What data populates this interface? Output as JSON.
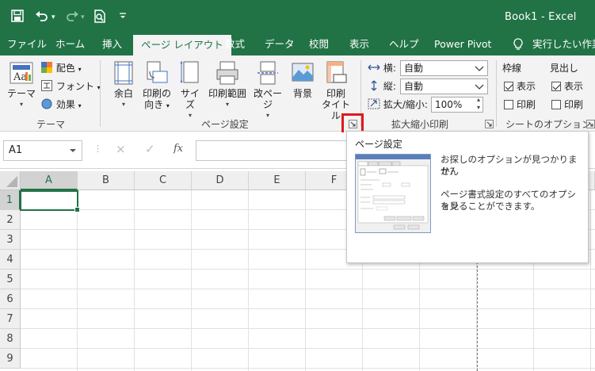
{
  "window": {
    "title": "Book1  -  Excel"
  },
  "quick_access": {
    "save_icon": "save-icon",
    "undo_icon": "undo-icon",
    "redo_icon": "redo-icon",
    "print_preview_icon": "print-preview-icon",
    "customize_icon": "customize-qat-icon"
  },
  "tabs": [
    {
      "label": "ファイル"
    },
    {
      "label": "ホーム"
    },
    {
      "label": "挿入"
    },
    {
      "label": "ページ レイアウト",
      "active": true
    },
    {
      "label": "数式"
    },
    {
      "label": "データ"
    },
    {
      "label": "校閲"
    },
    {
      "label": "表示"
    },
    {
      "label": "ヘルプ"
    },
    {
      "label": "Power Pivot"
    },
    {
      "label": "実行したい作業を"
    }
  ],
  "ribbon": {
    "themes": {
      "theme_label": "テーマ",
      "colors_label": "配色",
      "fonts_label": "フォント",
      "effects_label": "効果",
      "group_label": "テーマ"
    },
    "page_setup": {
      "margins_label": "余白",
      "orientation_label_1": "印刷の",
      "orientation_label_2": "向き",
      "size_label": "サイズ",
      "print_area_label": "印刷範囲",
      "breaks_label": "改ページ",
      "background_label": "背景",
      "print_titles_label_1": "印刷",
      "print_titles_label_2": "タイトル",
      "group_label": "ページ設定"
    },
    "scale_to_fit": {
      "width_label": "横:",
      "width_value": "自動",
      "height_label": "縦:",
      "height_value": "自動",
      "scale_label": "拡大/縮小:",
      "scale_value": "100%",
      "group_label": "拡大縮小印刷"
    },
    "sheet_options": {
      "gridlines_label": "枠線",
      "headings_label": "見出し",
      "view_label": "表示",
      "print_label": "印刷",
      "gridlines_view": true,
      "gridlines_print": false,
      "headings_view": true,
      "headings_print": false,
      "group_label": "シートのオプション"
    }
  },
  "formula_bar": {
    "name_box": "A1",
    "cancel_icon": "×",
    "enter_icon": "✓",
    "fx_label": "fx",
    "value": ""
  },
  "grid": {
    "columns": [
      "A",
      "B",
      "C",
      "D",
      "E",
      "F"
    ],
    "rows": [
      "1",
      "2",
      "3",
      "4",
      "5",
      "6",
      "7",
      "8",
      "9"
    ],
    "active_cell": "A1"
  },
  "tooltip": {
    "title": "ページ設定",
    "line1": "お探しのオプションが見つかりません",
    "line2": "か?",
    "line3": "ページ書式設定のすべてのオプション",
    "line4": "を見ることができます。"
  },
  "colors": {
    "brand": "#217346",
    "highlight": "#e0191b"
  }
}
